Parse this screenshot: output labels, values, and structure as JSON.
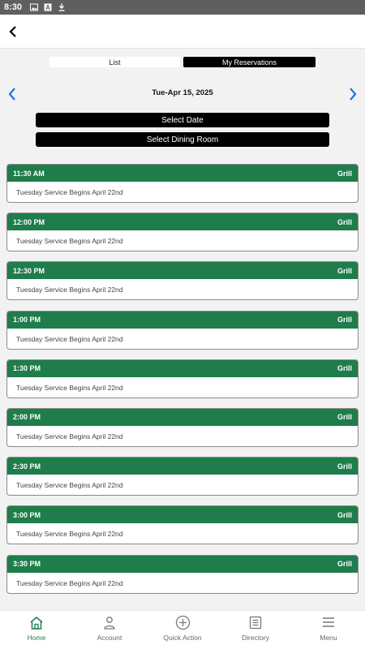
{
  "status_bar": {
    "time": "8:30"
  },
  "header": {
    "back_icon": "chevron-left-icon"
  },
  "tabs": {
    "list_label": "List",
    "reservations_label": "My Reservations"
  },
  "date_nav": {
    "date": "Tue-Apr 15, 2025"
  },
  "buttons": {
    "select_date": "Select Date",
    "select_room": "Select Dining Room"
  },
  "slots": [
    {
      "time": "11:30 AM",
      "room": "Grill",
      "note": "Tuesday Service Begins April 22nd"
    },
    {
      "time": "12:00 PM",
      "room": "Grill",
      "note": "Tuesday Service Begins April 22nd"
    },
    {
      "time": "12:30 PM",
      "room": "Grill",
      "note": "Tuesday Service Begins April 22nd"
    },
    {
      "time": "1:00 PM",
      "room": "Grill",
      "note": "Tuesday Service Begins April 22nd"
    },
    {
      "time": "1:30 PM",
      "room": "Grill",
      "note": "Tuesday Service Begins April 22nd"
    },
    {
      "time": "2:00 PM",
      "room": "Grill",
      "note": "Tuesday Service Begins April 22nd"
    },
    {
      "time": "2:30 PM",
      "room": "Grill",
      "note": "Tuesday Service Begins April 22nd"
    },
    {
      "time": "3:00 PM",
      "room": "Grill",
      "note": "Tuesday Service Begins April 22nd"
    },
    {
      "time": "3:30 PM",
      "room": "Grill",
      "note": "Tuesday Service Begins April 22nd"
    }
  ],
  "bottom_nav": {
    "home": "Home",
    "account": "Account",
    "quick_action": "Quick Action",
    "directory": "Directory",
    "menu": "Menu"
  },
  "colors": {
    "accent": "#1e7d4b",
    "arrow": "#1a73e8"
  }
}
